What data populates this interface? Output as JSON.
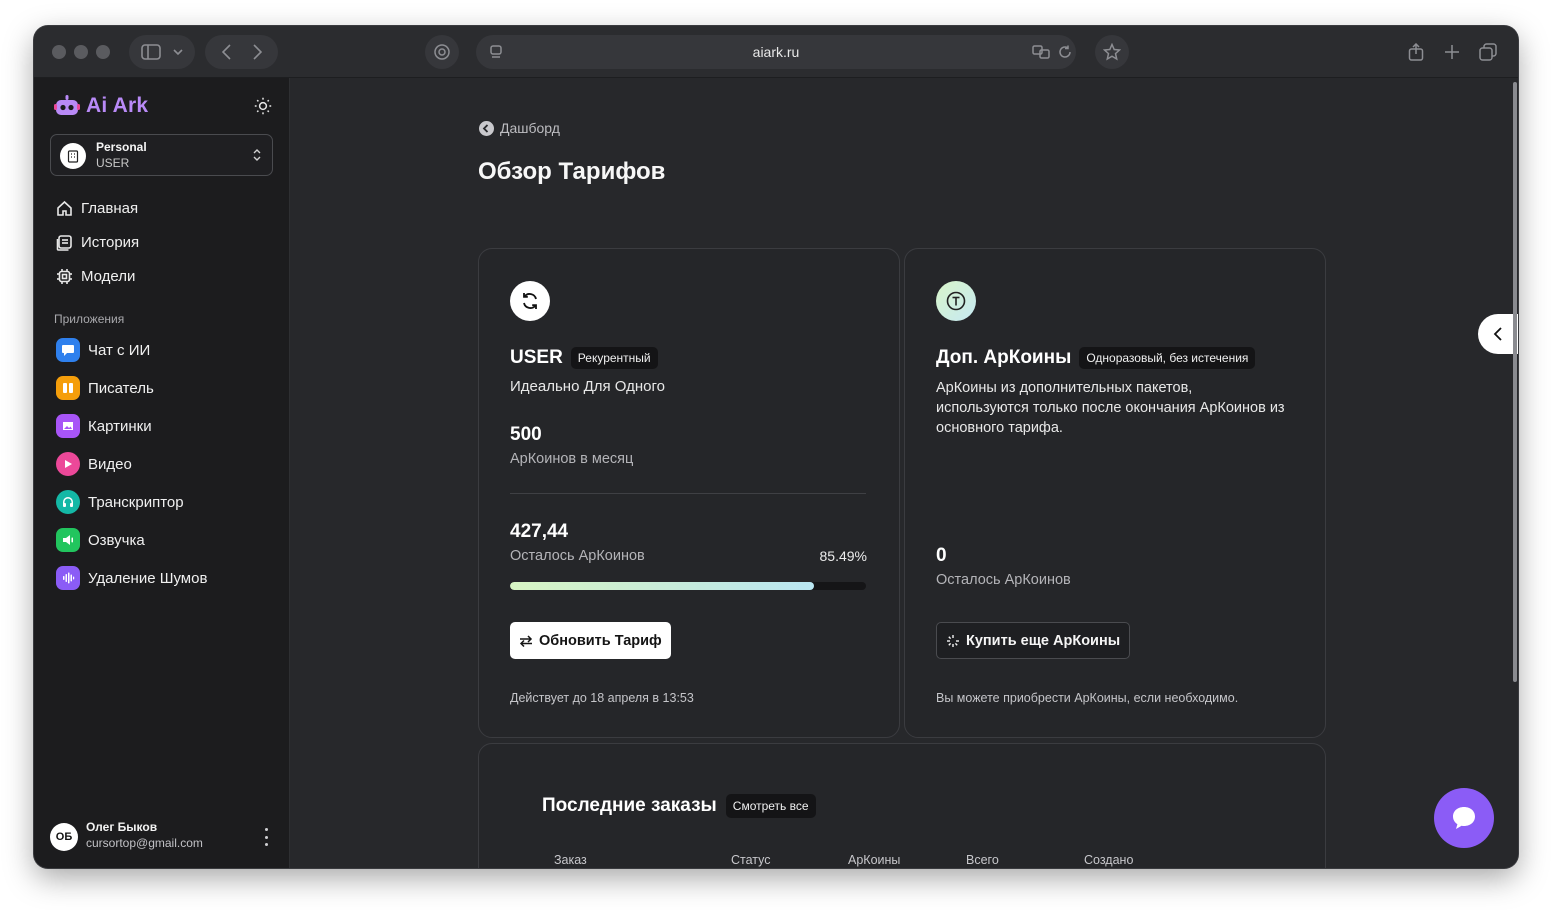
{
  "browser": {
    "url": "aiark.ru"
  },
  "sidebar": {
    "brand": "Ai Ark",
    "org": {
      "name": "Personal",
      "role": "USER"
    },
    "nav": [
      {
        "label": "Главная",
        "icon": "home-icon"
      },
      {
        "label": "История",
        "icon": "history-icon"
      },
      {
        "label": "Модели",
        "icon": "chip-icon"
      }
    ],
    "apps_label": "Приложения",
    "apps": [
      {
        "label": "Чат с ИИ",
        "icon": "chat-icon",
        "color": "#2f80ed"
      },
      {
        "label": "Писатель",
        "icon": "writer-icon",
        "color": "#f59e0b"
      },
      {
        "label": "Картинки",
        "icon": "image-icon",
        "color": "#a855f7"
      },
      {
        "label": "Видео",
        "icon": "video-icon",
        "color": "#ec4899"
      },
      {
        "label": "Транскриптор",
        "icon": "headphones-icon",
        "color": "#14b8a6"
      },
      {
        "label": "Озвучка",
        "icon": "speaker-icon",
        "color": "#22c55e"
      },
      {
        "label": "Удаление Шумов",
        "icon": "waveform-icon",
        "color": "#8b5cf6"
      }
    ],
    "user": {
      "initials": "ОБ",
      "name": "Олег Быков",
      "email": "cursortop@gmail.com"
    }
  },
  "main": {
    "back_label": "Дашборд",
    "title": "Обзор Тарифов",
    "plan_card": {
      "name": "USER",
      "tag": "Рекурентный",
      "subtitle": "Идеально Для Одного",
      "monthly_coins": "500",
      "monthly_label": "АрКоинов в месяц",
      "remaining": "427,44",
      "remaining_label": "Осталось АрКоинов",
      "percent_text": "85.49%",
      "percent": 85.49,
      "button": "Обновить Тариф",
      "valid_until": "Действует до 18 апреля в 13:53"
    },
    "extra_card": {
      "name": "Доп. АрКоины",
      "tag": "Одноразовый, без истечения",
      "description": "АрКоины из дополнительных пакетов, используются только после окончания АрКоинов из основного тарифа.",
      "remaining": "0",
      "remaining_label": "Осталось АрКоинов",
      "button": "Купить еще АрКоины",
      "note": "Вы можете приобрести АрКоины, если необходимо."
    },
    "orders": {
      "title": "Последние заказы",
      "view_all": "Смотреть все",
      "columns": [
        "Заказ",
        "Статус",
        "АрКоины",
        "Всего",
        "Создано"
      ]
    }
  }
}
